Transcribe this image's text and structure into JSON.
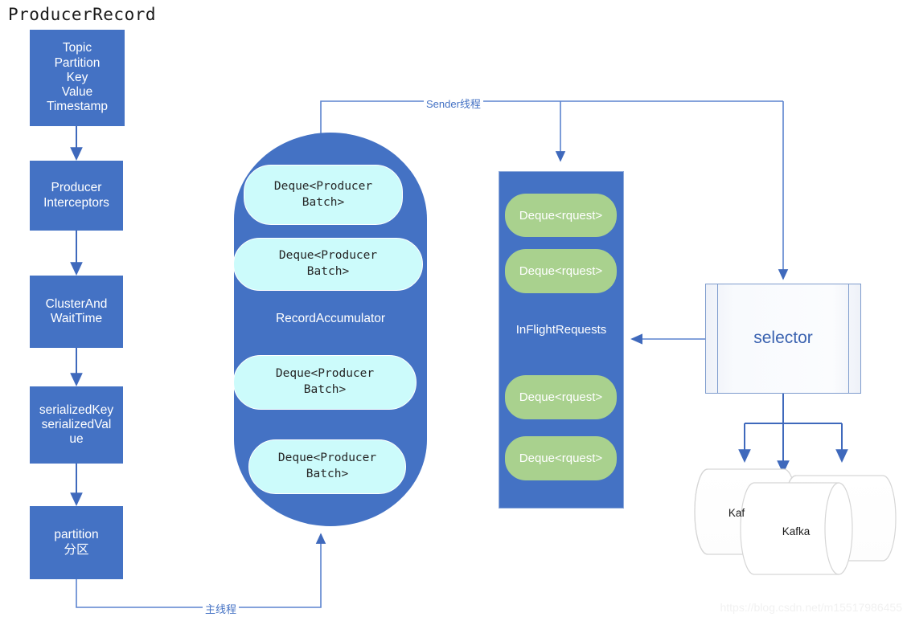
{
  "title": "ProducerRecord",
  "watermark": "https://blog.csdn.net/m15517986455",
  "colors": {
    "blue": "#4472C4",
    "cyan": "#CCFBFB",
    "green": "#A9D18E",
    "line": "#4472C4",
    "selector_text": "#3a62b0"
  },
  "pipeline": {
    "record_box": "Topic\nPartition\nKey\nValue\nTimestamp",
    "record_lines": [
      "Topic",
      "Partition",
      "Key",
      "Value",
      "Timestamp"
    ],
    "steps": [
      {
        "id": "producer-interceptors",
        "label": "Producer\nInterceptors"
      },
      {
        "id": "cluster-and-wait-time",
        "label": "ClusterAnd\nWaitTime"
      },
      {
        "id": "serialized-key-value",
        "label": "serializedKey\nserializedVal\nue"
      },
      {
        "id": "partition",
        "label": "partition\n分区"
      }
    ]
  },
  "accumulator": {
    "label": "RecordAccumulator",
    "deques": [
      "Deque<Producer\nBatch>",
      "Deque<Producer\nBatch>",
      "Deque<Producer\nBatch>",
      "Deque<Producer\nBatch>"
    ]
  },
  "inflight": {
    "label": "InFlightRequests",
    "deques": [
      "Deque<rquest>",
      "Deque<rquest>",
      "Deque<rquest>",
      "Deque<rquest>"
    ]
  },
  "selector": {
    "label": "selector"
  },
  "brokers": [
    {
      "id": "kafka-back-left",
      "label": "Kaf"
    },
    {
      "id": "kafka-front",
      "label": "Kafka"
    },
    {
      "id": "kafka-back-right",
      "label": ""
    }
  ],
  "edges": {
    "sender_thread": "Sender线程",
    "main_thread": "主线程"
  }
}
